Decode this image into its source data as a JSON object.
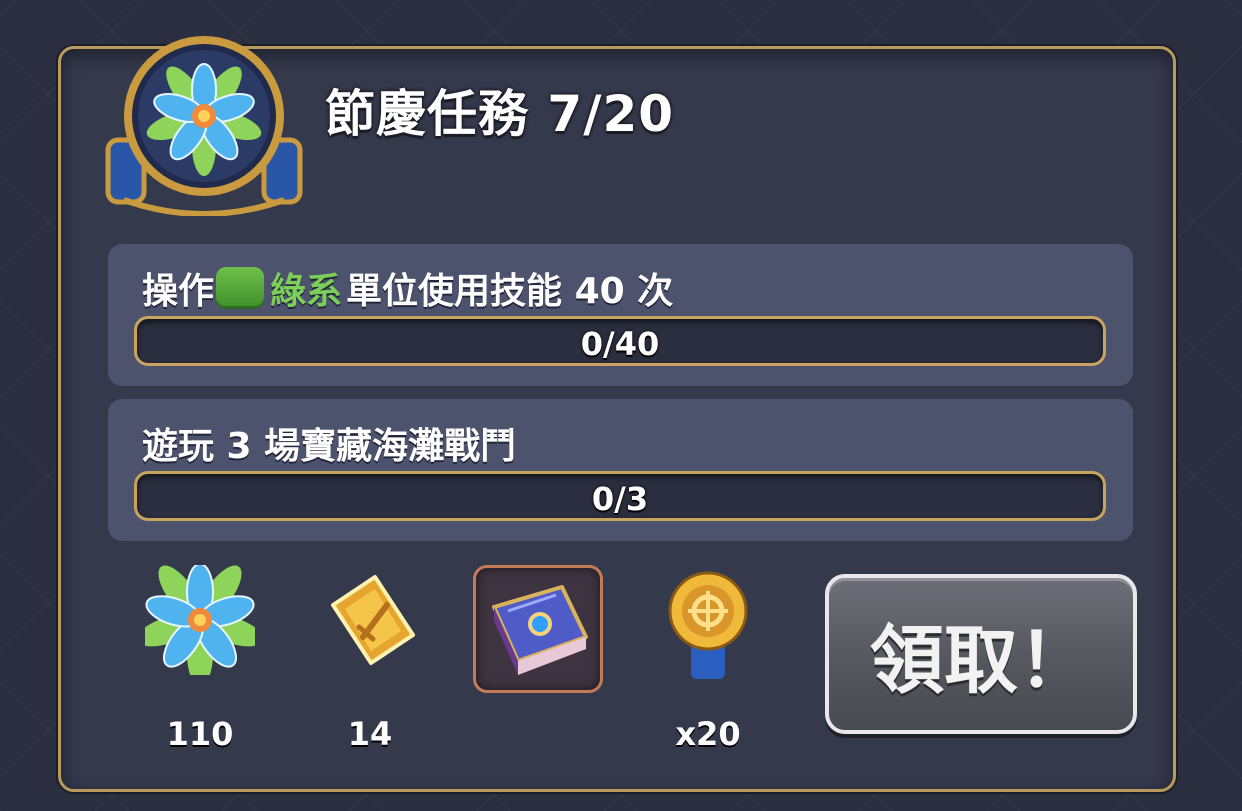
{
  "quest": {
    "title": "節慶任務 7/20",
    "emblem_icon": "blue-flower-emblem-icon"
  },
  "tasks": [
    {
      "text_prefix": "操作",
      "color_word": "綠系",
      "text_suffix": "單位使用技能 40 次",
      "progress_label": "0/40",
      "progress_fraction": 0,
      "color_chip": "#5fb23d"
    },
    {
      "text": "遊玩 3 場寶藏海灘戰鬥",
      "progress_label": "0/3",
      "progress_fraction": 0
    }
  ],
  "rewards": [
    {
      "icon": "blue-flower-icon",
      "count": "110"
    },
    {
      "icon": "gold-sword-ticket-icon",
      "count": "14"
    },
    {
      "icon": "purple-spellbook-icon",
      "count": ""
    },
    {
      "icon": "gold-medal-icon",
      "count": "x20"
    }
  ],
  "claim_button": {
    "label": "領取！"
  },
  "colors": {
    "panel_bg": "#35394c",
    "panel_border": "#b89a5e",
    "task_bg": "#4d526d",
    "green_text": "#7cd05a",
    "bar_border": "#c9a45e"
  }
}
